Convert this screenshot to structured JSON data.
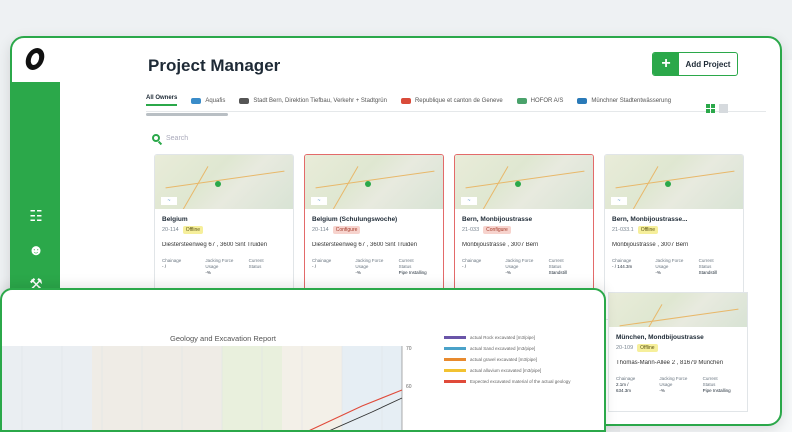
{
  "app": {
    "title": "Project Manager",
    "add_button_label": "Add Project",
    "search_placeholder": "Search"
  },
  "tabs": [
    {
      "label": "All Owners",
      "active": true,
      "color": "#2ba84a"
    },
    {
      "label": "Aquafis",
      "color": "#3a8cc9"
    },
    {
      "label": "Stadt Bern, Direktion Tiefbau, Verkehr + Stadtgrün",
      "color": "#555555"
    },
    {
      "label": "Republique et canton de Geneve",
      "color": "#d94b3a"
    },
    {
      "label": "HOFOR A/S",
      "color": "#4aa26b"
    },
    {
      "label": "Münchner Stadtentwässerung",
      "color": "#2a7ab8"
    }
  ],
  "cards": [
    {
      "name": "Belgium",
      "code": "20-114",
      "status": "Offline",
      "status_type": "offline",
      "address": "Diestersteenweg 67 , 3600 Sint Truiden",
      "alert": false,
      "chainage": "-",
      "chainage_unit": "/",
      "jacking_force": "-%",
      "current_status": ""
    },
    {
      "name": "Belgium (Schulungswoche)",
      "code": "20-114",
      "status": "Configure",
      "status_type": "configure",
      "address": "Diestersteenweg 67 , 3600 Sint Truiden",
      "alert": true,
      "chainage": "-",
      "chainage_unit": "/",
      "jacking_force": "-%",
      "current_status": "Pipe Installing"
    },
    {
      "name": "Bern, Monbijoustrasse",
      "code": "21-033",
      "status": "Configure",
      "status_type": "configure",
      "address": "Monbijoustrasse , 3007 Bern",
      "alert": true,
      "chainage": "-",
      "chainage_unit": "/",
      "jacking_force": "-%",
      "current_status": "Standstill"
    },
    {
      "name": "Bern, Monbijoustrasse...",
      "code": "21-033.1",
      "status": "Offline",
      "status_type": "offline",
      "address": "Monbijoustrasse , 3007 Bern",
      "alert": false,
      "chainage": "-",
      "chainage_unit": "/ 144.3m",
      "jacking_force": "-%",
      "current_status": "Standstill"
    }
  ],
  "card_labels": {
    "chainage": "Chainage",
    "jacking_force": "Jacking Force",
    "usage": "Usage",
    "current_status": "Current",
    "status_word": "Status"
  },
  "detached_card": {
    "name": "München, Mondbijoustrasse",
    "code": "20-109",
    "status": "Offline",
    "address": "Thomas-Mann-Allee 2 , 81679 München",
    "chainage": "2.1m /",
    "chainage_total": "634.3m",
    "jacking_force": "-%",
    "current_status": "Pipe Installing"
  },
  "report": {
    "title": "Geology and Excavation Report",
    "y_tick_top": "70",
    "y_tick_mid": "60"
  },
  "chart_data": {
    "type": "line",
    "title": "Geology and Excavation Report",
    "series": [
      {
        "name": "actual Rock excavated [m3/pipe]",
        "color": "#6a55a8"
      },
      {
        "name": "actual Sand excavated [m3/pipe]",
        "color": "#4aa2c9"
      },
      {
        "name": "actual gravel excavated [m3/pipe]",
        "color": "#e88a2e"
      },
      {
        "name": "actual alluvium excavated [m3/pipe]",
        "color": "#f2c231"
      },
      {
        "name": "Expected excavated material of the actual geology",
        "color": "#e04a3a"
      }
    ],
    "ylim": [
      0,
      70
    ],
    "grid": true,
    "legend": "right"
  },
  "colors": {
    "accent": "#2ba84a",
    "alert": "#e36a6a"
  }
}
